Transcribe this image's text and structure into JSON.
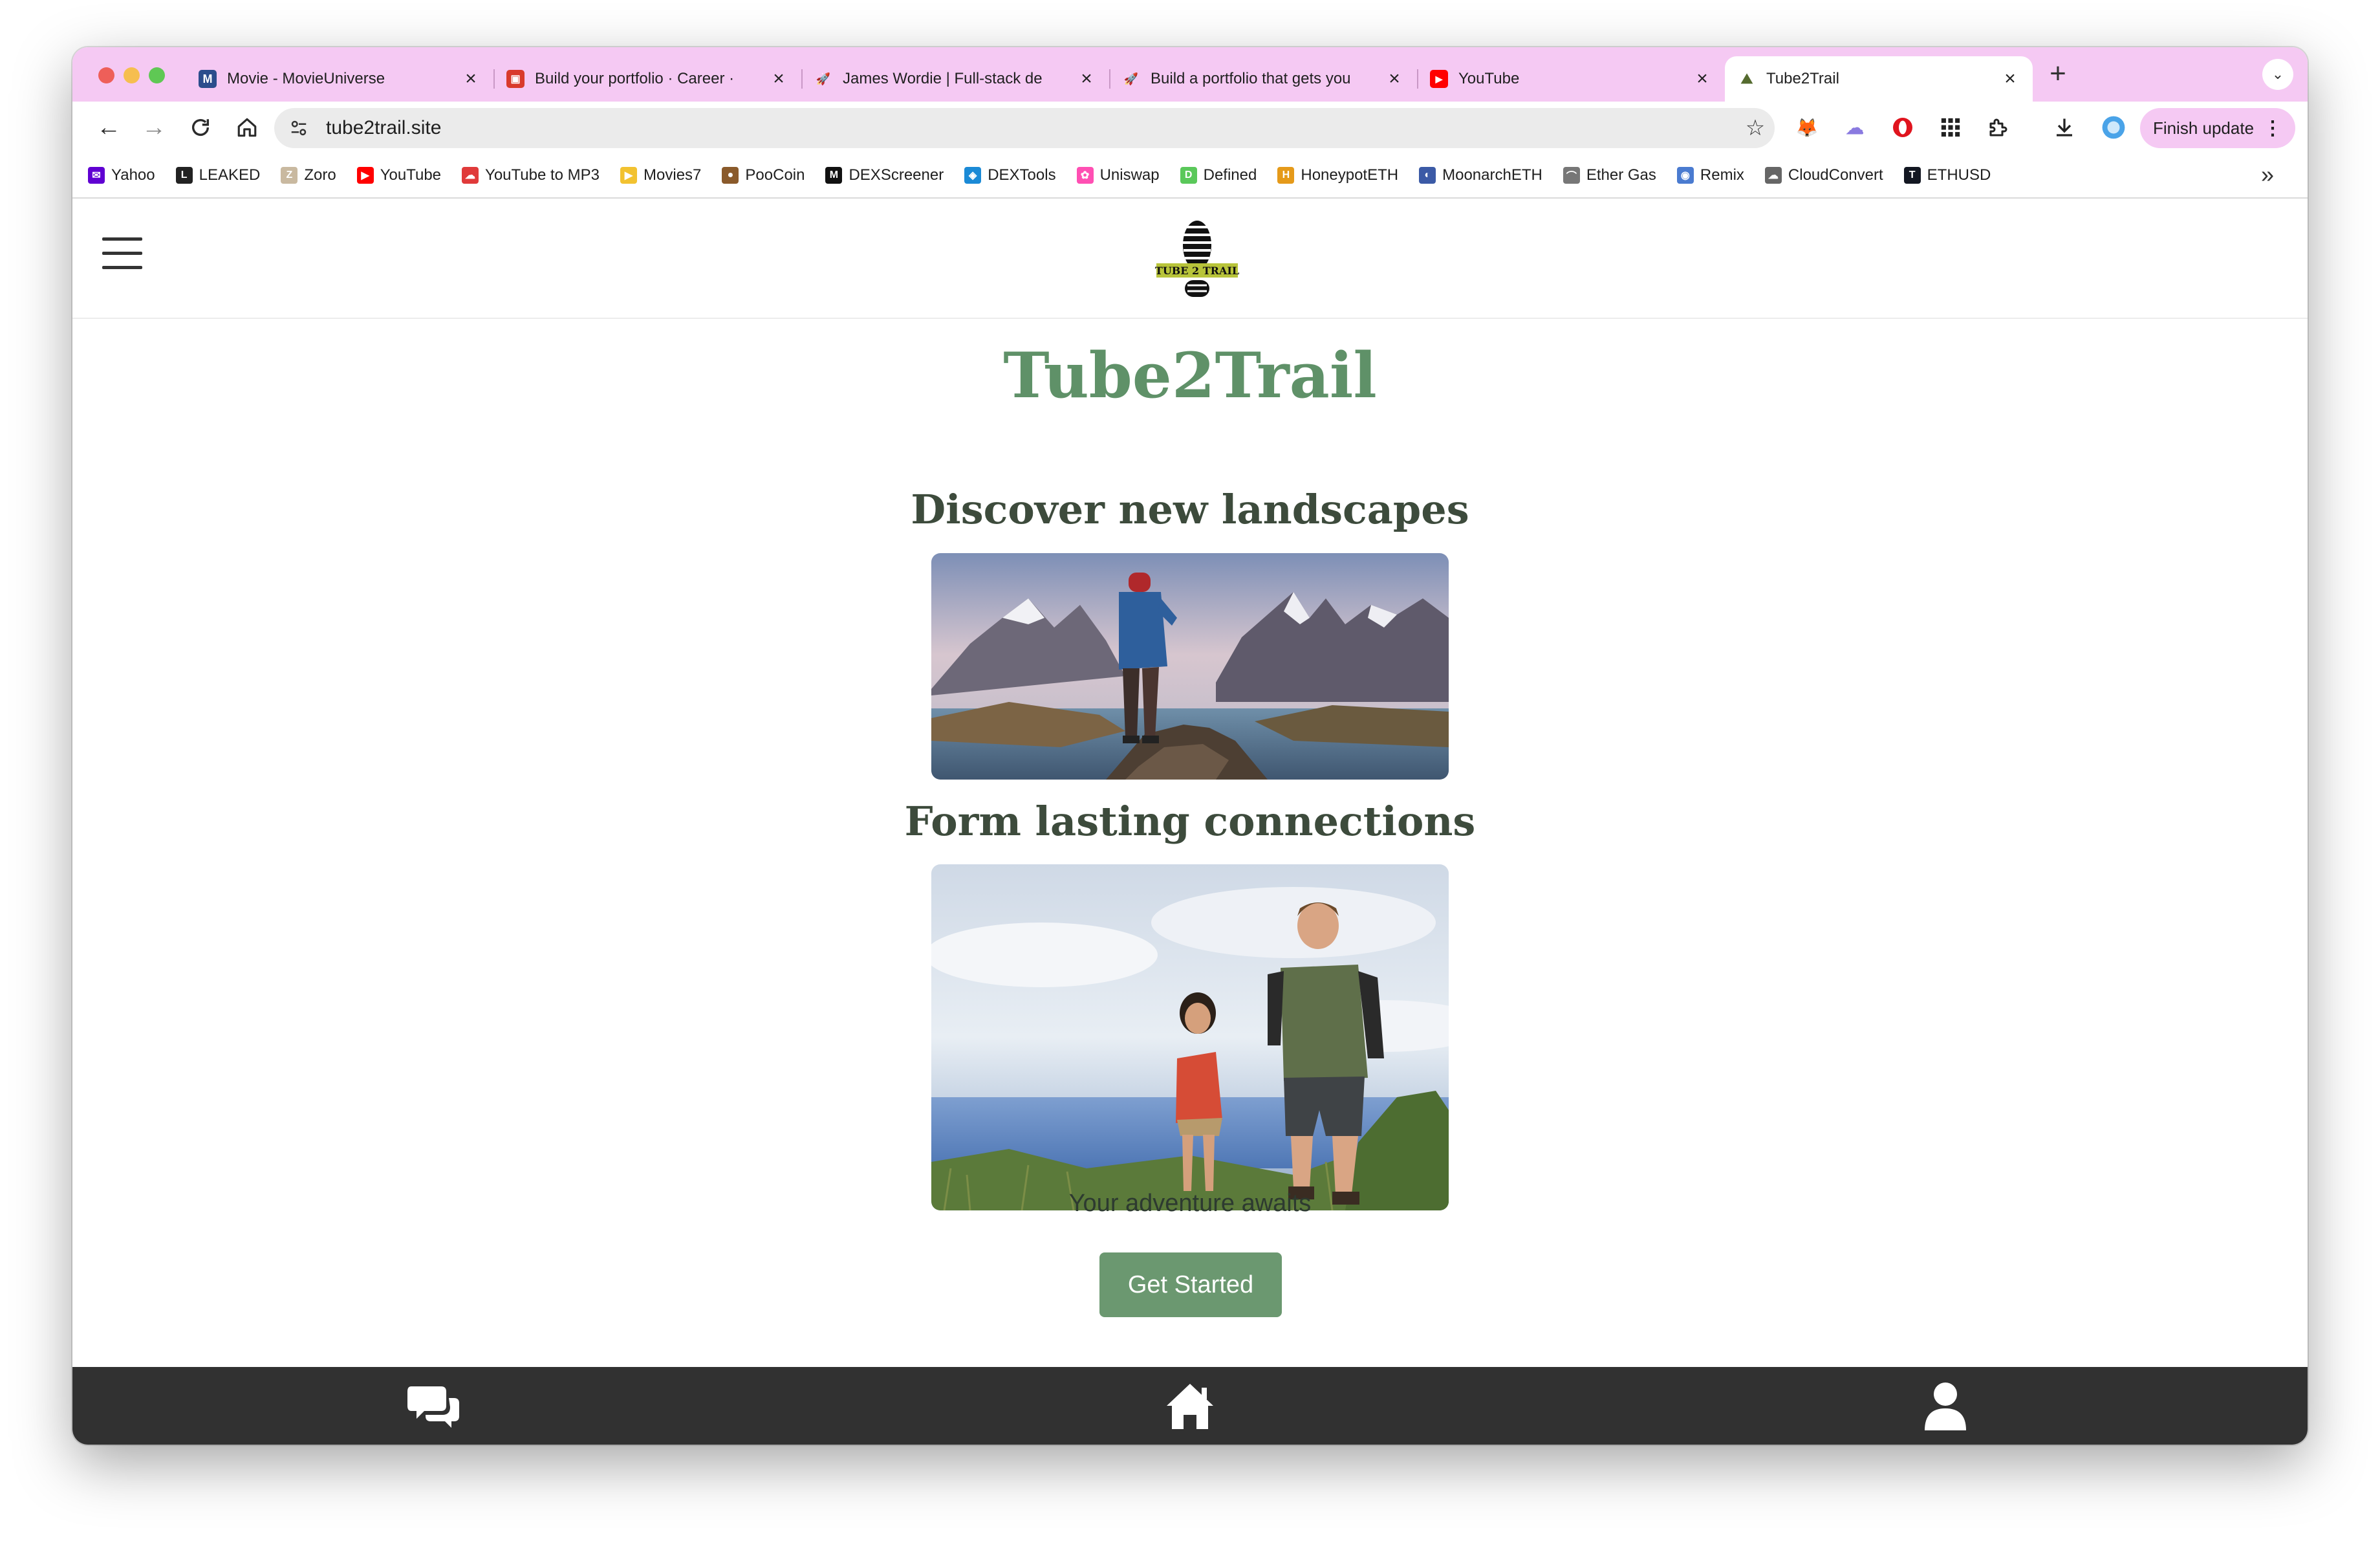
{
  "browser": {
    "tabs": [
      {
        "title": "Movie - MovieUniverse",
        "favicon": "movieuniverse-icon",
        "color": "#2b4d8c"
      },
      {
        "title": "Build your portfolio · Career · ",
        "favicon": "career-icon",
        "color": "#d93a2b"
      },
      {
        "title": "James Wordie | Full-stack de",
        "favicon": "rocket-icon",
        "color": "#e8eaf0"
      },
      {
        "title": "Build a portfolio that gets you",
        "favicon": "rocket-icon",
        "color": "#e8eaf0"
      },
      {
        "title": "YouTube",
        "favicon": "youtube-icon",
        "color": "#ff0000"
      },
      {
        "title": "Tube2Trail",
        "favicon": "tube2trail-icon",
        "color": "#ffffff",
        "active": true
      }
    ],
    "address_url": "tube2trail.site",
    "finish_update_label": "Finish update",
    "bookmarks": [
      {
        "label": "Yahoo",
        "icon": "yahoo-icon",
        "color": "#6001d2"
      },
      {
        "label": "LEAKED",
        "icon": "leaked-icon",
        "color": "#222222"
      },
      {
        "label": "Zoro",
        "icon": "zoro-icon",
        "color": "#c9b9a0"
      },
      {
        "label": "YouTube",
        "icon": "youtube-icon",
        "color": "#ff0000"
      },
      {
        "label": "YouTube to MP3",
        "icon": "cloud-download-icon",
        "color": "#e03a3a"
      },
      {
        "label": "Movies7",
        "icon": "play-icon",
        "color": "#f2c230"
      },
      {
        "label": "PooCoin",
        "icon": "poocoin-icon",
        "color": "#8a5a2b"
      },
      {
        "label": "DEXScreener",
        "icon": "dexscreener-icon",
        "color": "#111111"
      },
      {
        "label": "DEXTools",
        "icon": "dextools-icon",
        "color": "#1b8ad6"
      },
      {
        "label": "Uniswap",
        "icon": "uniswap-icon",
        "color": "#ff4fb3"
      },
      {
        "label": "Defined",
        "icon": "defined-icon",
        "color": "#5ac85a"
      },
      {
        "label": "HoneypotETH",
        "icon": "honeypot-icon",
        "color": "#e59a1a"
      },
      {
        "label": "MoonarchETH",
        "icon": "moonarch-icon",
        "color": "#3b5aa6"
      },
      {
        "label": "Ether Gas",
        "icon": "gas-icon",
        "color": "#777777"
      },
      {
        "label": "Remix",
        "icon": "remix-icon",
        "color": "#4a7bd0"
      },
      {
        "label": "CloudConvert",
        "icon": "cloud-icon",
        "color": "#666666"
      },
      {
        "label": "ETHUSD",
        "icon": "tradingview-icon",
        "color": "#131722"
      }
    ]
  },
  "site": {
    "logo_text": "TUBE 2 TRAIL",
    "title": "Tube2Trail",
    "section1_heading": "Discover new landscapes",
    "section2_heading": "Form lasting connections",
    "tagline": "Your adventure awaits",
    "cta_label": "Get Started"
  },
  "colors": {
    "brand_green": "#5f9168",
    "button_green": "#6b9870",
    "tab_bar": "#f5c9f3",
    "footer": "#313131"
  }
}
